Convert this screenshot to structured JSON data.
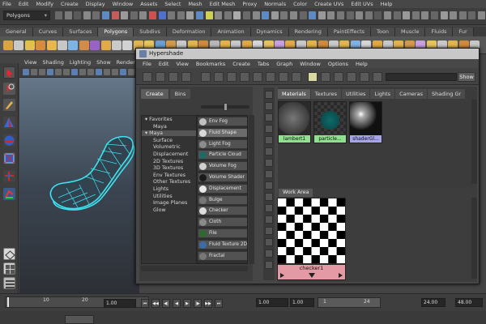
{
  "main_menu": [
    "File",
    "Edit",
    "Modify",
    "Create",
    "Display",
    "Window",
    "Assets",
    "Select",
    "Mesh",
    "Edit Mesh",
    "Proxy",
    "Normals",
    "Color",
    "Create UVs",
    "Edit UVs",
    "Help"
  ],
  "mode_selector": "Polygons",
  "shelf_tabs": [
    "General",
    "Curves",
    "Surfaces",
    "Polygons",
    "Subdivs",
    "Deformation",
    "Animation",
    "Dynamics",
    "Rendering",
    "PaintEffects",
    "Toon",
    "Muscle",
    "Fluids",
    "Fur"
  ],
  "active_shelf_tab": "Polygons",
  "viewport_menu": [
    "View",
    "Shading",
    "Lighting",
    "Show",
    "Renderer"
  ],
  "hypershade": {
    "title": "Hypershade",
    "menu": [
      "File",
      "Edit",
      "View",
      "Bookmarks",
      "Create",
      "Tabs",
      "Graph",
      "Window",
      "Options",
      "Help"
    ],
    "show_button": "Show",
    "create_tabs": [
      "Create",
      "Bins"
    ],
    "active_create_tab": "Create",
    "categories": [
      {
        "label": "▾ Favorites",
        "indent": 0,
        "selected": false
      },
      {
        "label": "Maya",
        "indent": 1,
        "selected": false
      },
      {
        "label": "▾ Maya",
        "indent": 0,
        "selected": true
      },
      {
        "label": "Surface",
        "indent": 1,
        "selected": false
      },
      {
        "label": "Volumetric",
        "indent": 1,
        "selected": false
      },
      {
        "label": "Displacement",
        "indent": 1,
        "selected": false
      },
      {
        "label": "2D Textures",
        "indent": 1,
        "selected": false
      },
      {
        "label": "3D Textures",
        "indent": 1,
        "selected": false
      },
      {
        "label": "Env Textures",
        "indent": 1,
        "selected": false
      },
      {
        "label": "Other Textures",
        "indent": 1,
        "selected": false
      },
      {
        "label": "Lights",
        "indent": 1,
        "selected": false
      },
      {
        "label": "Utilities",
        "indent": 1,
        "selected": false
      },
      {
        "label": "Image Planes",
        "indent": 1,
        "selected": false
      },
      {
        "label": "Glow",
        "indent": 1,
        "selected": false
      }
    ],
    "nodes": [
      {
        "label": "Env Fog",
        "color": "#bfbfbf"
      },
      {
        "label": "Fluid Shape",
        "color": "#d9d9d9"
      },
      {
        "label": "Light Fog",
        "color": "#8c8c8c"
      },
      {
        "label": "Particle Cloud",
        "color": "#1f6a66"
      },
      {
        "label": "Volume Fog",
        "color": "#cfcfcf"
      },
      {
        "label": "Volume Shader",
        "color": "#1b1b1b"
      },
      {
        "label": "Displacement",
        "color": "#e8e8e8"
      },
      {
        "label": "Bulge",
        "color": "#777777"
      },
      {
        "label": "Checker",
        "color": "#dddddd"
      },
      {
        "label": "Cloth",
        "color": "#8a8a8a"
      },
      {
        "label": "File",
        "color": "#2e6a2e"
      },
      {
        "label": "Fluid Texture 2D",
        "color": "#3a6da8"
      },
      {
        "label": "Fractal",
        "color": "#777777"
      }
    ],
    "material_tabs": [
      "Materials",
      "Textures",
      "Utilities",
      "Lights",
      "Cameras",
      "Shading Gr"
    ],
    "active_material_tab": "Materials",
    "swatches": [
      {
        "label": "lambert1",
        "label_color": "#8fe08f"
      },
      {
        "label": "particle...",
        "label_color": "#8fe08f"
      },
      {
        "label": "shaderGl...",
        "label_color": "#a6a3e8"
      }
    ],
    "work_area_tab": "Work Area",
    "work_node_label": "checker1"
  },
  "timeline": {
    "tick_10": "10",
    "tick_20": "20",
    "current_frame": "1.00"
  },
  "range": {
    "start": "1.00",
    "start2": "1.00",
    "range_start": "1",
    "range_end": "24",
    "end": "24.00",
    "end2": "48.00"
  }
}
